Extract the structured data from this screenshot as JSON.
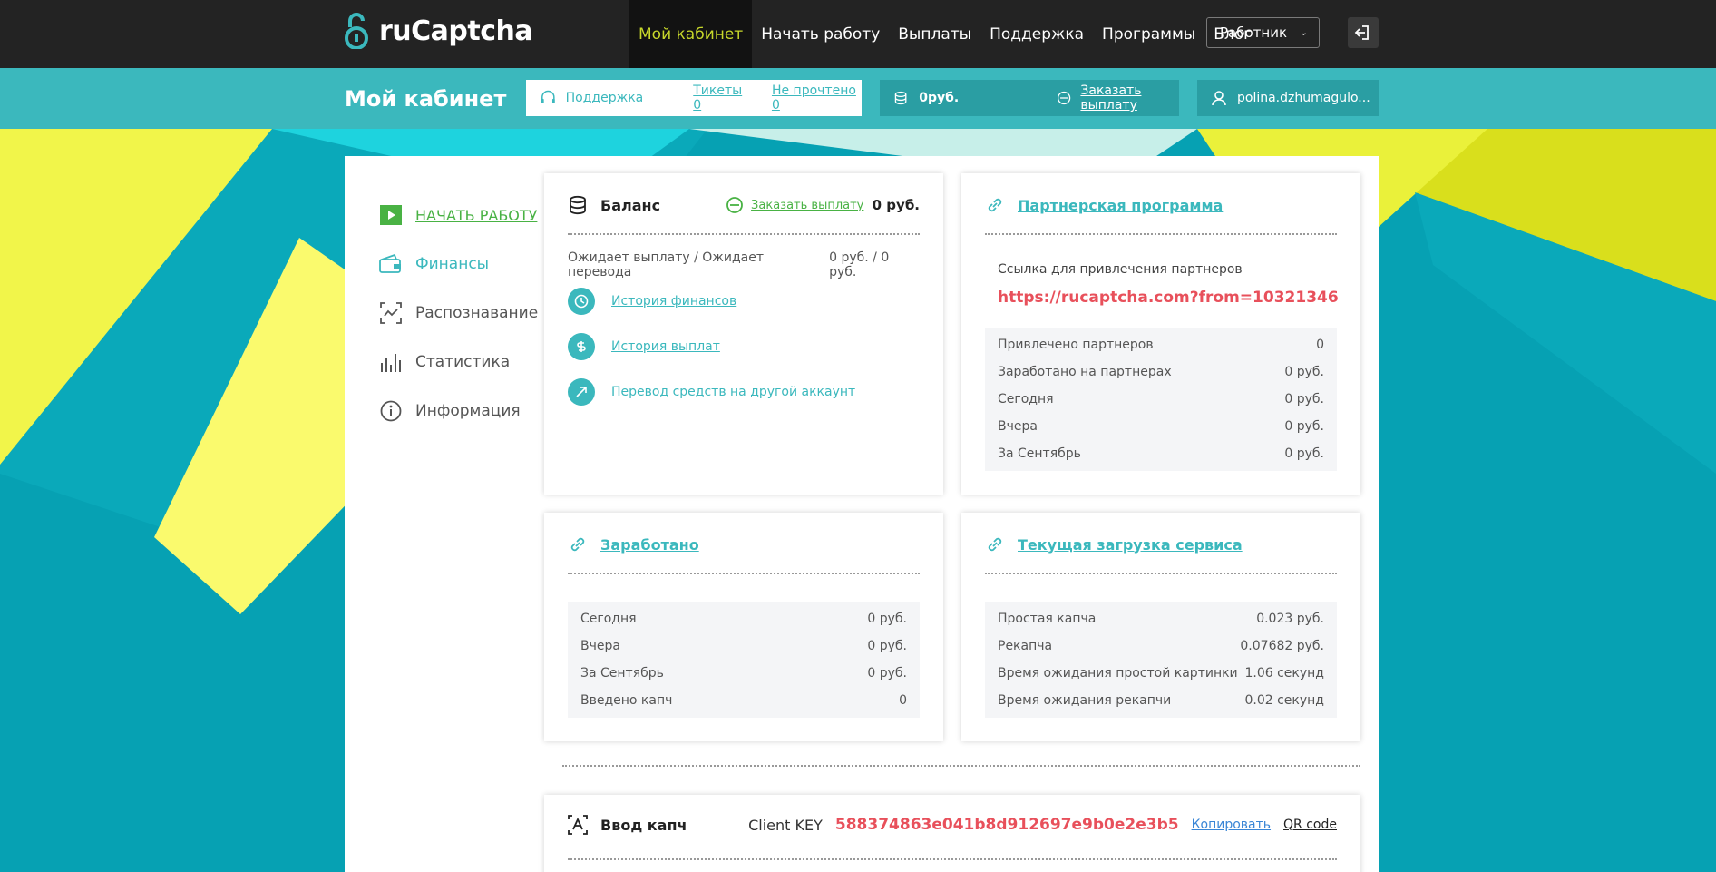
{
  "brand": {
    "name": "ruCaptcha"
  },
  "nav": {
    "items": [
      "Мой кабинет",
      "Начать работу",
      "Выплаты",
      "Поддержка",
      "Программы",
      "Блог"
    ],
    "role": "Работник"
  },
  "subbar": {
    "title": "Мой кабинет",
    "support": "Поддержка",
    "tickets": "Тикеты 0",
    "unread": "Не прочтено 0",
    "balance": "0руб.",
    "order_payout": "Заказать выплату",
    "user": "polina.dzhumagulo..."
  },
  "sidebar": {
    "items": [
      {
        "label": "НАЧАТЬ РАБОТУ",
        "icon": "play-icon"
      },
      {
        "label": "Финансы",
        "icon": "wallet-icon"
      },
      {
        "label": "Распознавание",
        "icon": "scan-icon"
      },
      {
        "label": "Статистика",
        "icon": "bar-chart-icon"
      },
      {
        "label": "Информация",
        "icon": "info-icon"
      }
    ]
  },
  "balance_card": {
    "title": "Баланс",
    "order_payout": "Заказать выплату",
    "amount": "0 руб.",
    "pending_label": "Ожидает выплату / Ожидает перевода",
    "pending_value": "0 руб. / 0 руб.",
    "links": [
      "История финансов",
      "История выплат",
      "Перевод средств на другой аккаунт"
    ]
  },
  "partner_card": {
    "title": "Партнерская программа",
    "ref_label": "Ссылка для привлечения партнеров",
    "ref_link": "https://rucaptcha.com?from=10321346",
    "rows": [
      {
        "label": "Привлечено партнеров",
        "value": "0"
      },
      {
        "label": "Заработано на партнерах",
        "value": "0 руб."
      },
      {
        "label": "Сегодня",
        "value": "0 руб."
      },
      {
        "label": "Вчера",
        "value": "0 руб."
      },
      {
        "label": "За Сентябрь",
        "value": "0 руб."
      }
    ]
  },
  "earned_card": {
    "title": "Заработано",
    "rows": [
      {
        "label": "Сегодня",
        "value": "0 руб."
      },
      {
        "label": "Вчера",
        "value": "0 руб."
      },
      {
        "label": "За Сентябрь",
        "value": "0 руб."
      },
      {
        "label": "Введено капч",
        "value": "0"
      }
    ]
  },
  "load_card": {
    "title": "Текущая загрузка сервиса",
    "rows": [
      {
        "label": "Простая капча",
        "value": "0.023 руб."
      },
      {
        "label": "Рекапча",
        "value": "0.07682 руб."
      },
      {
        "label": "Время ожидания простой картинки",
        "value": "1.06 секунд"
      },
      {
        "label": "Время ожидания рекапчи",
        "value": "0.02 секунд"
      }
    ]
  },
  "captcha_card": {
    "title": "Ввод капч",
    "key_label": "Client KEY",
    "key": "588374863e041b8d912697e9b0e2e3b5",
    "copy": "Копировать",
    "qr": "QR code"
  },
  "colors": {
    "accent": "#3bb8bd",
    "green": "#49b244",
    "red": "#e8505b",
    "topbar": "#232323",
    "yellow": "#c8d82b"
  }
}
